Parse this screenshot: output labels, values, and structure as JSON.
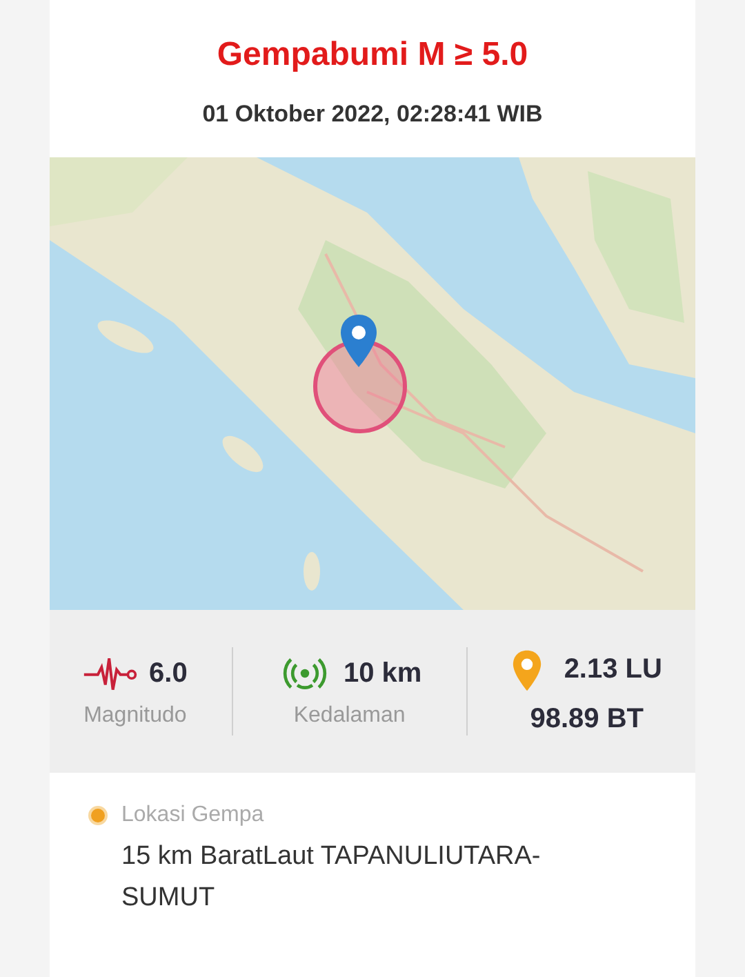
{
  "title": "Gempabumi M ≥ 5.0",
  "datetime": "01 Oktober 2022, 02:28:41 WIB",
  "stats": [
    {
      "kind": "magnitude",
      "value": "6.0",
      "label": "Magnitudo"
    },
    {
      "kind": "depth",
      "value": "10 km",
      "label": "Kedalaman"
    },
    {
      "kind": "coordinates",
      "value": "2.13 LU",
      "value_2": "98.89 BT"
    }
  ],
  "location": {
    "label": "Lokasi Gempa",
    "text": "15 km BaratLaut TAPANULIUTARA-SUMUT"
  }
}
